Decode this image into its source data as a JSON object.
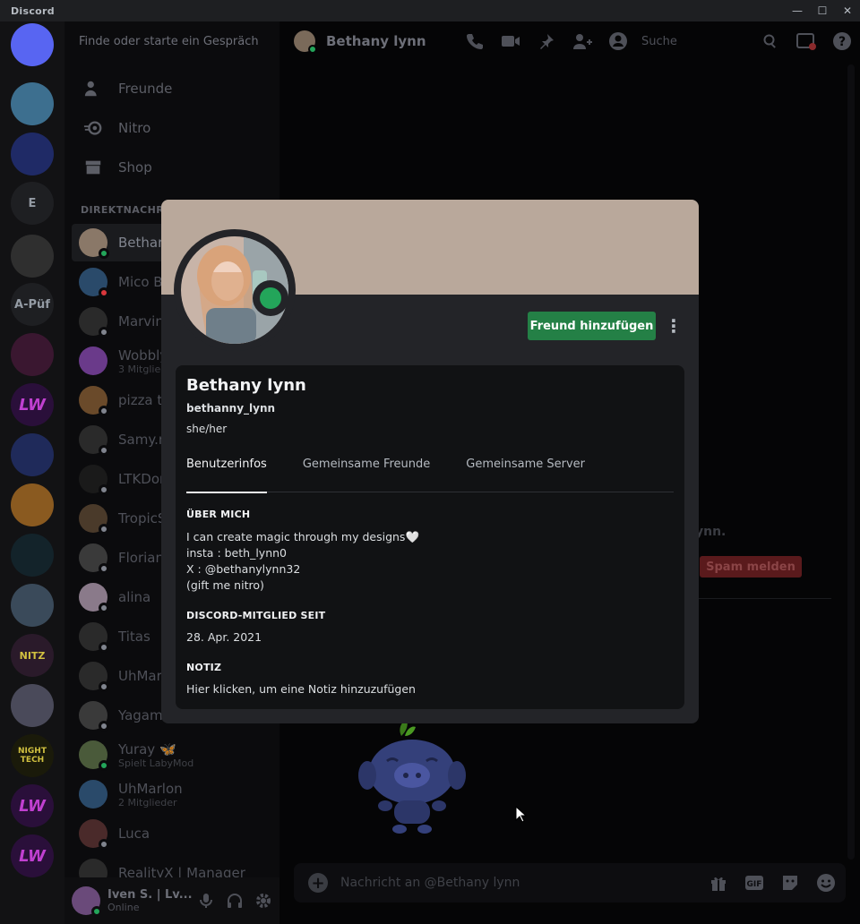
{
  "app": {
    "title": "Discord"
  },
  "window_controls": {
    "minimize": "—",
    "maximize": "☐",
    "close": "✕"
  },
  "servers": [
    {
      "name": "home",
      "label": "",
      "color": "#5865f2"
    },
    {
      "name": "server-avatar-1",
      "label": "",
      "color": "#3d6f8f"
    },
    {
      "name": "server-folder",
      "label": "",
      "color": "#1f2a66"
    },
    {
      "name": "server-e",
      "label": "E",
      "color": "#1e1f22"
    },
    {
      "name": "server-avatar-2",
      "label": "",
      "color": "#2f2f2f"
    },
    {
      "name": "server-a-puf",
      "label": "A-Püf",
      "color": "#1e1f22"
    },
    {
      "name": "server-pink",
      "label": "",
      "color": "#3a1730"
    },
    {
      "name": "server-lw-1",
      "label": "LW",
      "color": "#2a0f3a"
    },
    {
      "name": "server-cloud",
      "label": "",
      "color": "#1f2a5a"
    },
    {
      "name": "server-orange",
      "label": "",
      "color": "#8a5a20"
    },
    {
      "name": "server-dark",
      "label": "",
      "color": "#13232a"
    },
    {
      "name": "server-avatar-3",
      "label": "",
      "color": "#3a4a5a"
    },
    {
      "name": "server-nitz",
      "label": "NITZ",
      "color": "#2a1a2a"
    },
    {
      "name": "server-avatar-4",
      "label": "",
      "color": "#4a4a5a"
    },
    {
      "name": "server-nighttech",
      "label": "NIGHT TECH",
      "color": "#1a1a0a"
    },
    {
      "name": "server-lw-2",
      "label": "LW",
      "color": "#2a0f3a"
    },
    {
      "name": "server-lw-3",
      "label": "LW",
      "color": "#2a0f3a"
    }
  ],
  "search": {
    "placeholder": "Finde oder starte ein Gespräch"
  },
  "nav": [
    {
      "label": "Freunde",
      "icon": "friends-icon"
    },
    {
      "label": "Nitro",
      "icon": "nitro-icon"
    },
    {
      "label": "Shop",
      "icon": "shop-icon"
    }
  ],
  "dm_header": "DIREKTNACHRICHTEN",
  "dms": [
    {
      "name": "Bethany lynn",
      "sub": "",
      "color": "#8a7868",
      "status": "#23a55a",
      "active": true
    },
    {
      "name": "Mico B",
      "sub": "",
      "color": "#2a4a6a",
      "status": "#da373c"
    },
    {
      "name": "Marvin",
      "sub": "",
      "color": "#2a2a2a",
      "status": "#80848e"
    },
    {
      "name": "Wobbly",
      "sub": "3 Mitglieder",
      "color": "#6a3a8a",
      "status": ""
    },
    {
      "name": "pizza ti",
      "sub": "",
      "color": "#6a4a2a",
      "status": "#80848e"
    },
    {
      "name": "Samy.m",
      "sub": "",
      "color": "#2a2a2a",
      "status": "#80848e"
    },
    {
      "name": "LTKDon",
      "sub": "",
      "color": "#1a1a1a",
      "status": "#80848e"
    },
    {
      "name": "TropicS",
      "sub": "",
      "color": "#4a3a2a",
      "status": "#80848e"
    },
    {
      "name": "Florian",
      "sub": "",
      "color": "#3a3a3a",
      "status": "#80848e"
    },
    {
      "name": "alina",
      "sub": "",
      "color": "#8a7a8a",
      "status": "#80848e"
    },
    {
      "name": "Titas",
      "sub": "",
      "color": "#2a2a2a",
      "status": "#80848e"
    },
    {
      "name": "UhMar",
      "sub": "",
      "color": "#2a2a2a",
      "status": "#80848e"
    },
    {
      "name": "Yagami",
      "sub": "",
      "color": "#3a3a3a",
      "status": "#80848e"
    },
    {
      "name": "Yuray 🦋",
      "sub": "Spielt LabyMod",
      "color": "#4a5a3a",
      "status": "#23a55a"
    },
    {
      "name": "UhMarlon",
      "sub": "2 Mitglieder",
      "color": "#2a4a6a",
      "status": ""
    },
    {
      "name": "Luca",
      "sub": "",
      "color": "#4a2a2a",
      "status": "#80848e"
    },
    {
      "name": "RealityX | Manager",
      "sub": "",
      "color": "#2a2a2a",
      "status": ""
    }
  ],
  "user_panel": {
    "name": "Iven S. | Lv...",
    "status": "Online"
  },
  "topbar": {
    "username": "Bethany lynn",
    "search_placeholder": "Suche"
  },
  "background": {
    "partial_text": "ynn.",
    "spam_label": "Spam melden"
  },
  "message_bar": {
    "placeholder": "Nachricht an @Bethany lynn",
    "gif_label": "GIF"
  },
  "profile": {
    "banner_color": "#b9a89b",
    "add_friend_label": "Freund hinzufügen",
    "display_name": "Bethany lynn",
    "username": "bethanny_lynn",
    "pronouns": "she/her",
    "tabs": [
      "Benutzerinfos",
      "Gemeinsame Freunde",
      "Gemeinsame Server"
    ],
    "about_heading": "ÜBER MICH",
    "about_lines": [
      "I can create magic through my designs🤍",
      "insta : beth_lynn0",
      "X : @bethanylynn32",
      "(gift me nitro)"
    ],
    "member_heading": "DISCORD-MITGLIED SEIT",
    "member_since": "28. Apr. 2021",
    "note_heading": "NOTIZ",
    "note_placeholder": "Hier klicken, um eine Notiz hinzuzufügen"
  }
}
